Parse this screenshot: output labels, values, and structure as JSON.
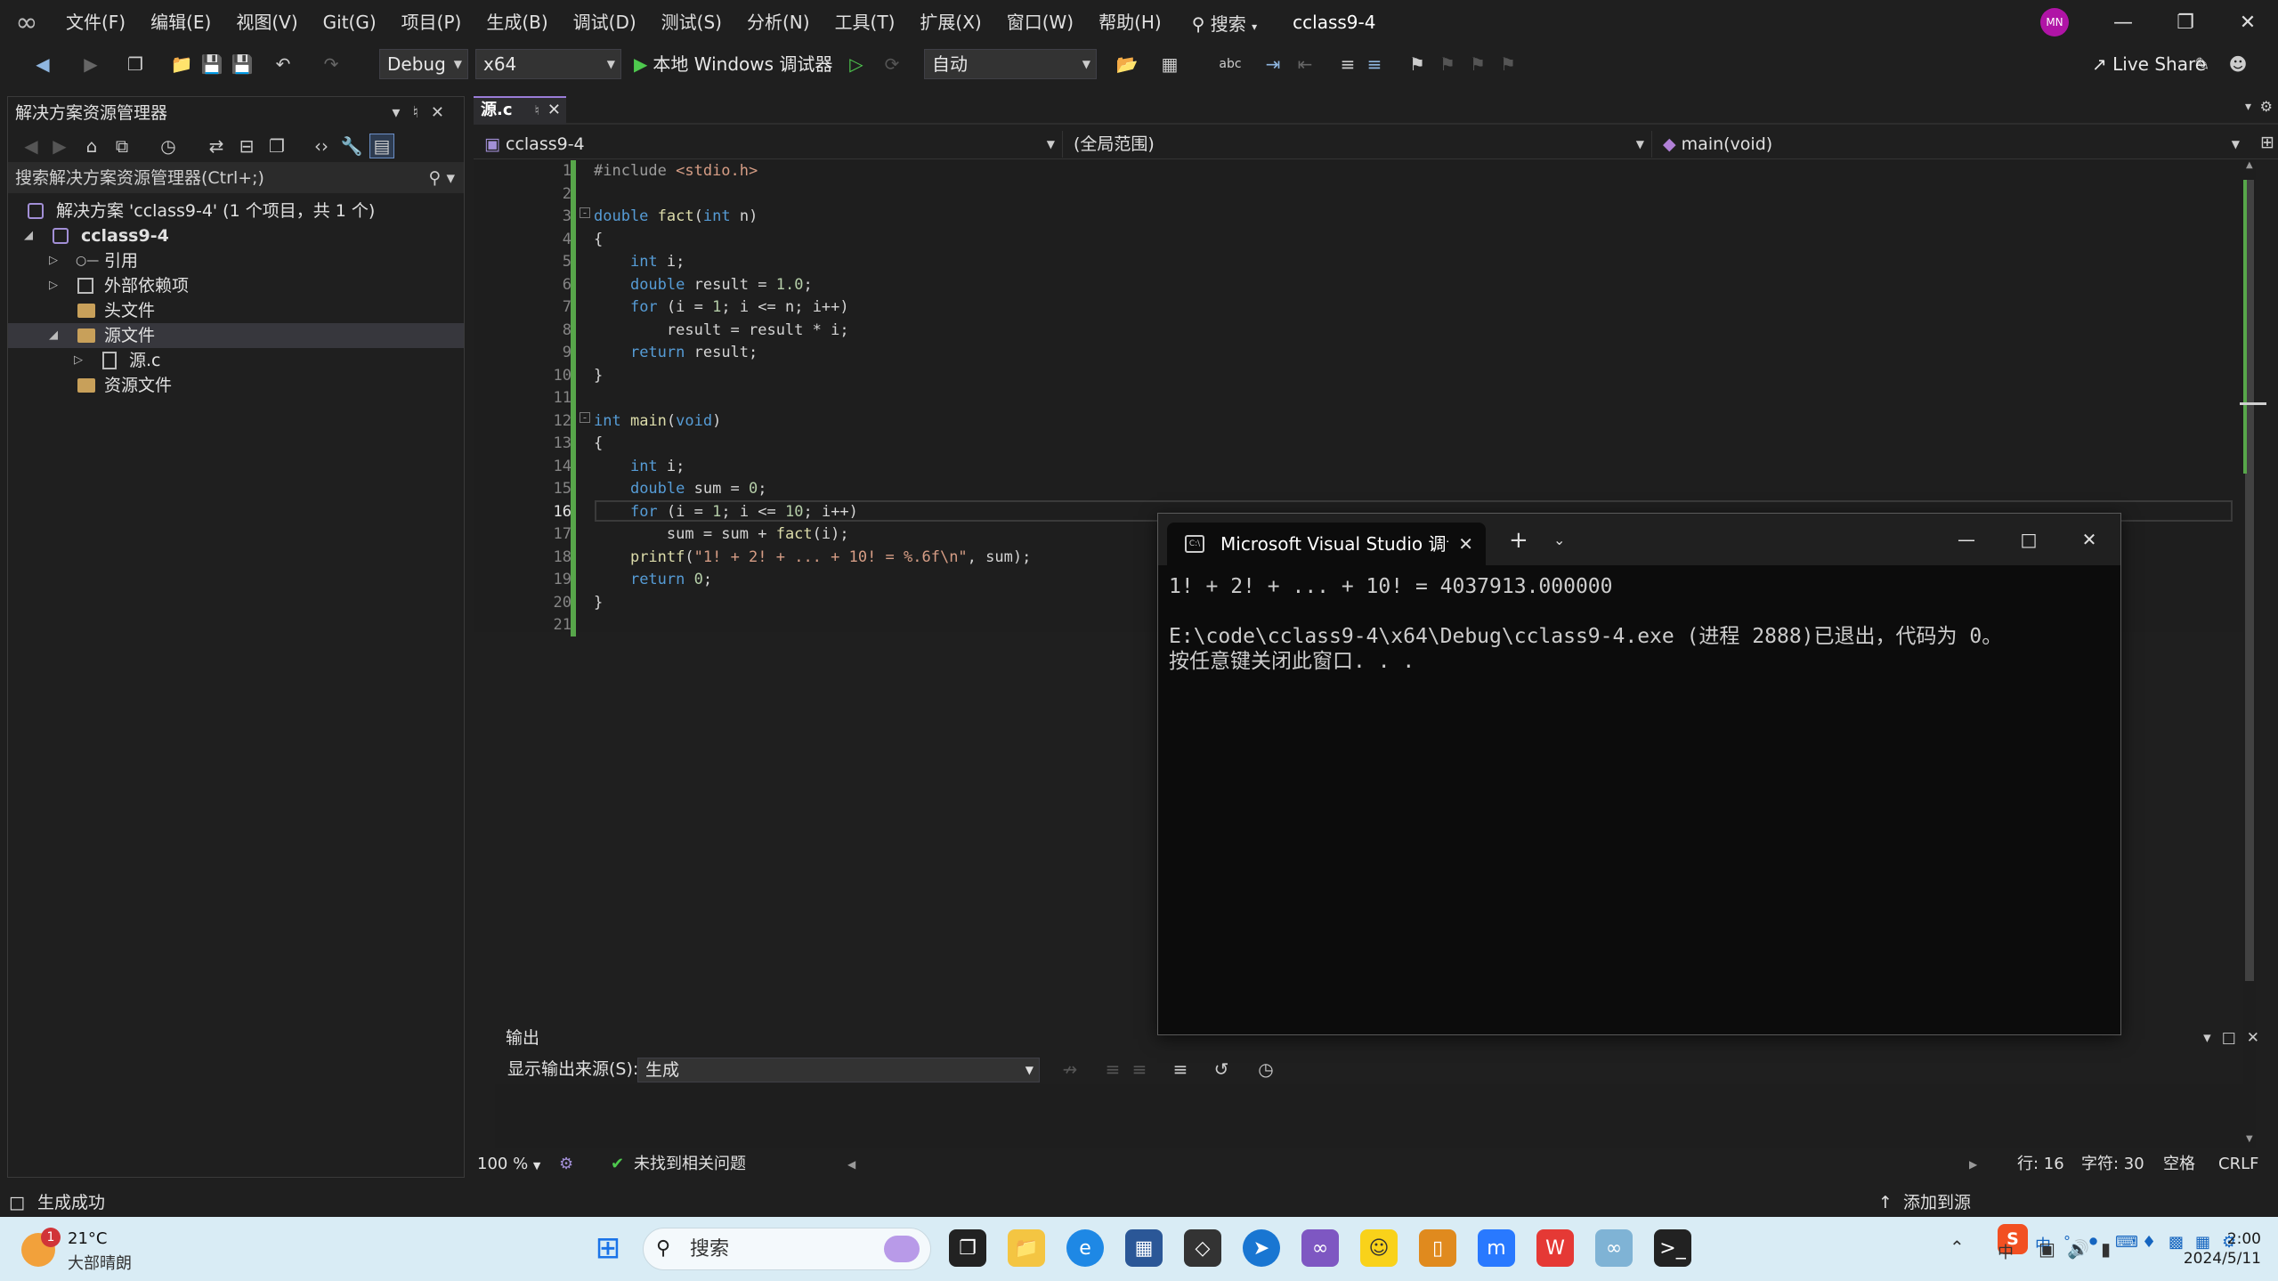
{
  "titlebar": {
    "menu": [
      "文件(F)",
      "编辑(E)",
      "视图(V)",
      "Git(G)",
      "项目(P)",
      "生成(B)",
      "调试(D)",
      "测试(S)",
      "分析(N)",
      "工具(T)",
      "扩展(X)",
      "窗口(W)",
      "帮助(H)"
    ],
    "search_label": "搜索",
    "project_title": "cclass9-4",
    "avatar_initials": "MN"
  },
  "toolbar": {
    "config": "Debug",
    "platform": "x64",
    "run_label": "本地 Windows 调试器",
    "target": "自动",
    "liveshare": "Live Share"
  },
  "solution_explorer": {
    "title": "解决方案资源管理器",
    "search_placeholder": "搜索解决方案资源管理器(Ctrl+;)",
    "items": [
      {
        "label": "解决方案 'cclass9-4' (1 个项目，共 1 个)",
        "level": 0
      },
      {
        "label": "cclass9-4",
        "level": 1
      },
      {
        "label": "引用",
        "level": 2
      },
      {
        "label": "外部依赖项",
        "level": 2
      },
      {
        "label": "头文件",
        "level": 2
      },
      {
        "label": "源文件",
        "level": 2
      },
      {
        "label": "源.c",
        "level": 3
      },
      {
        "label": "资源文件",
        "level": 2
      }
    ]
  },
  "editor": {
    "tab_label": "源.c",
    "nav_project": "cclass9-4",
    "nav_scope": "(全局范围)",
    "nav_member": "main(void)",
    "line_numbers": [
      "1",
      "2",
      "3",
      "4",
      "5",
      "6",
      "7",
      "8",
      "9",
      "10",
      "11",
      "12",
      "13",
      "14",
      "15",
      "16",
      "17",
      "18",
      "19",
      "20",
      "21"
    ],
    "current_line": "16"
  },
  "console": {
    "title": "Microsoft Visual Studio 调试",
    "lines": [
      "1! + 2! + ... + 10! = 4037913.000000",
      "",
      "E:\\code\\cclass9-4\\x64\\Debug\\cclass9-4.exe (进程 2888)已退出，代码为 0。",
      "按任意键关闭此窗口. . ."
    ]
  },
  "output": {
    "title": "输出",
    "source_label": "显示输出来源(S):",
    "source_value": "生成"
  },
  "edit_status": {
    "zoom": "100 %",
    "issues": "未找到相关问题",
    "line": "行: 16",
    "char": "字符: 30",
    "indent": "空格",
    "eol": "CRLF"
  },
  "statusbar": {
    "left": "生成成功",
    "right": "添加到源"
  },
  "taskbar": {
    "weather_temp": "21°C",
    "weather_desc": "大部晴朗",
    "weather_badge": "1",
    "search_label": "搜索",
    "time": "2:00",
    "date": "2024/5/11"
  },
  "colors": {
    "accent": "#9a7cd8",
    "change_bar": "#57a64a",
    "keyword": "#569cd6",
    "string": "#d69d85"
  }
}
